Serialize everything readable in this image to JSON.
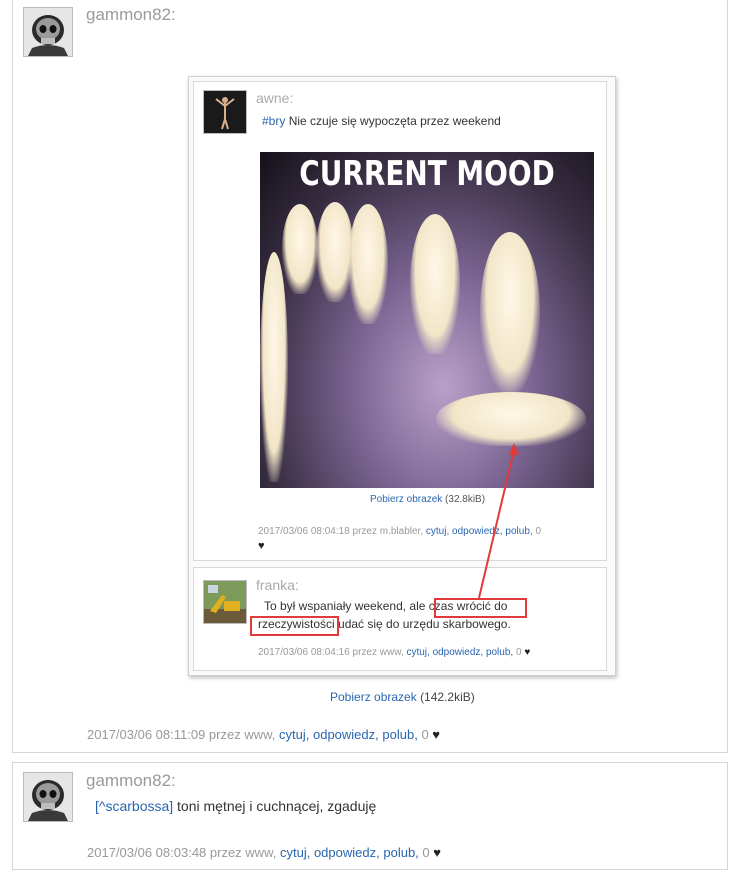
{
  "post1": {
    "author": "gammon82:",
    "avatar_icon": "skull-avatar-icon",
    "download_label": "Pobierz obrazek",
    "download_size": "(142.2kiB)",
    "meta_prefix": "2017/03/06 08:11:09 przez www,",
    "actions": [
      "cytuj,",
      "odpowiedz,",
      "polub,"
    ],
    "likes": "0",
    "embedded": {
      "post_a": {
        "author": "awne:",
        "tag": "#bry",
        "text": "Nie czuje się wypoczęta przez weekend",
        "image_caption": "CURRENT MOOD",
        "download_label": "Pobierz obrazek",
        "download_size": "(32.8kiB)",
        "meta_prefix": "2017/03/06 08:04:18 przez m.blabler,",
        "actions": [
          "cytuj,",
          "odpowiedz,",
          "polub,"
        ],
        "likes": "0"
      },
      "post_b": {
        "author": "franka:",
        "text_line1_a": "To był wspaniały weekend, ale",
        "text_line1_b": "czas wrócić do",
        "text_line2_a": "rzeczywistości",
        "text_line2_b": "udać się do urzędu skarbowego.",
        "meta_prefix": "2017/03/06 08:04:16 przez www,",
        "actions": [
          "cytuj,",
          "odpowiedz,",
          "polub,"
        ],
        "likes": "0"
      }
    }
  },
  "post2": {
    "author": "gammon82:",
    "avatar_icon": "skull-avatar-icon",
    "mention": "[^scarbossa]",
    "text": "toni mętnej i cuchnącej, zgaduję",
    "meta_prefix": "2017/03/06 08:03:48 przez www,",
    "actions": [
      "cytuj,",
      "odpowiedz,",
      "polub,"
    ],
    "likes": "0"
  },
  "colors": {
    "link": "#2a66b0",
    "highlight": "#e03a3a",
    "meta": "#999999"
  }
}
